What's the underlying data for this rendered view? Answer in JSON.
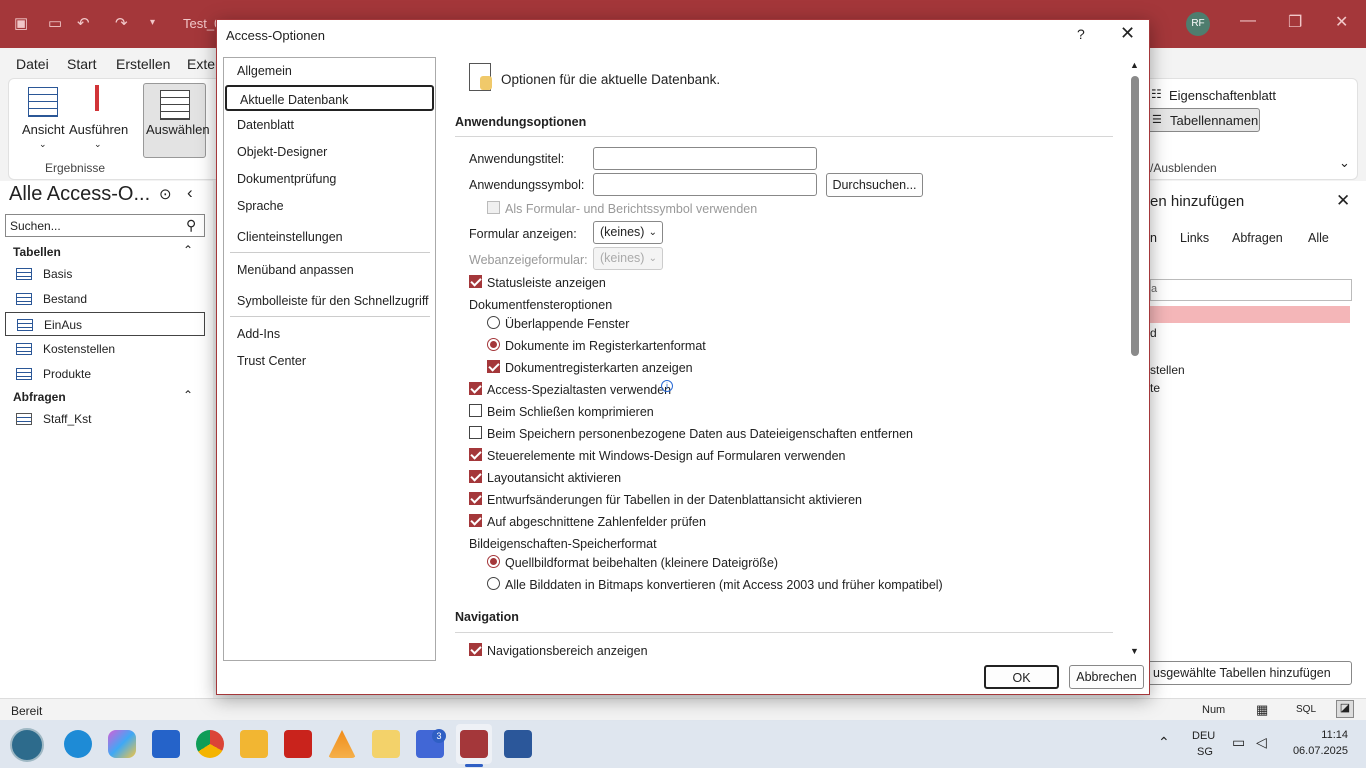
{
  "app": {
    "title": "Test_0",
    "avatar": "RF"
  },
  "ribbon": {
    "tabs": [
      "Datei",
      "Start",
      "Erstellen",
      "Exter"
    ],
    "ansicht": "Ansicht",
    "ausfuehren": "Ausführen",
    "auswaehlen": "Auswählen",
    "group_label": "Ergebnisse",
    "eigenschaftenblatt": "Eigenschaftenblatt",
    "tabellennamen": "Tabellennamen",
    "ausblenden": "/Ausblenden"
  },
  "navpane": {
    "title": "Alle Access-O...",
    "search_placeholder": "Suchen...",
    "groups": [
      {
        "label": "Tabellen",
        "items": [
          "Basis",
          "Bestand",
          "EinAus",
          "Kostenstellen",
          "Produkte"
        ]
      },
      {
        "label": "Abfragen",
        "items": [
          "Staff_Kst"
        ]
      }
    ]
  },
  "rightpane": {
    "title": "en hinzufügen",
    "tabs": [
      "n",
      "Links",
      "Abfragen",
      "Alle"
    ],
    "list": [
      "a",
      "",
      "d",
      "stellen",
      "te"
    ],
    "add_button": "usgewählte Tabellen hinzufügen"
  },
  "statusbar": {
    "left": "Bereit",
    "num": "Num",
    "sql": "SQL"
  },
  "taskbar": {
    "teams_badge": "3",
    "lang1": "DEU",
    "lang2": "SG",
    "time": "11:14",
    "date": "06.07.2025"
  },
  "dialog": {
    "title": "Access-Optionen",
    "help": "?",
    "close": "✕",
    "categories": [
      "Allgemein",
      "Aktuelle Datenbank",
      "Datenblatt",
      "Objekt-Designer",
      "Dokumentprüfung",
      "Sprache",
      "Clienteinstellungen",
      "Menüband anpassen",
      "Symbolleiste für den Schnellzugriff",
      "Add-Ins",
      "Trust Center"
    ],
    "header": "Optionen für die aktuelle Datenbank.",
    "section_app": "Anwendungsoptionen",
    "app_title_label": "Anwendungstitel:",
    "app_title_value": "",
    "app_icon_label": "Anwendungssymbol:",
    "app_icon_value": "",
    "browse": "Durchsuchen...",
    "as_form_icon": "Als Formular- und Berichtssymbol verwenden",
    "form_show_label": "Formular anzeigen:",
    "form_show_value": "(keines)",
    "web_form_label": "Webanzeigeformular:",
    "web_form_value": "(keines)",
    "statusbar_opt": "Statusleiste anzeigen",
    "docwin_label": "Dokumentfensteroptionen",
    "overlap": "Überlappende Fenster",
    "tabbed": "Dokumente im Registerkartenformat",
    "doc_tabs": "Dokumentregisterkarten anzeigen",
    "special_keys": "Access-Spezialtasten verwenden",
    "compact": "Beim Schließen komprimieren",
    "remove_personal": "Beim Speichern personenbezogene Daten aus Dateieigenschaften entfernen",
    "win_design": "Steuerelemente mit Windows-Design auf Formularen verwenden",
    "layout_view": "Layoutansicht aktivieren",
    "design_changes": "Entwurfsänderungen für Tabellen in der Datenblattansicht aktivieren",
    "truncated": "Auf abgeschnittene Zahlenfelder prüfen",
    "pic_format_label": "Bildeigenschaften-Speicherformat",
    "keep_source": "Quellbildformat beibehalten (kleinere Dateigröße)",
    "convert_bitmaps": "Alle Bilddaten in Bitmaps konvertieren (mit Access 2003 und früher kompatibel)",
    "section_nav": "Navigation",
    "show_nav": "Navigationsbereich anzeigen",
    "ok": "OK",
    "cancel": "Abbrechen"
  },
  "colors": {
    "accent": "#a4373a",
    "titlebar": "#a4373a"
  }
}
